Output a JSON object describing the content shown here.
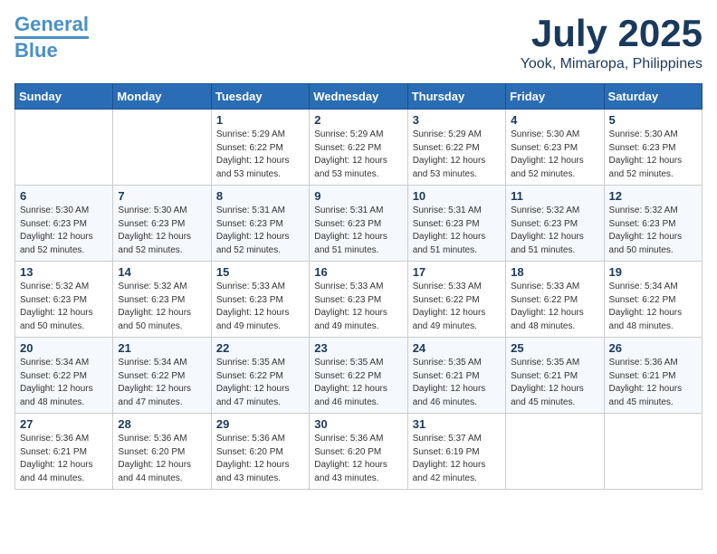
{
  "header": {
    "logo_line1": "General",
    "logo_line2": "Blue",
    "month": "July 2025",
    "location": "Yook, Mimaropa, Philippines"
  },
  "days_of_week": [
    "Sunday",
    "Monday",
    "Tuesday",
    "Wednesday",
    "Thursday",
    "Friday",
    "Saturday"
  ],
  "weeks": [
    [
      {
        "day": "",
        "content": ""
      },
      {
        "day": "",
        "content": ""
      },
      {
        "day": "1",
        "content": "Sunrise: 5:29 AM\nSunset: 6:22 PM\nDaylight: 12 hours and 53 minutes."
      },
      {
        "day": "2",
        "content": "Sunrise: 5:29 AM\nSunset: 6:22 PM\nDaylight: 12 hours and 53 minutes."
      },
      {
        "day": "3",
        "content": "Sunrise: 5:29 AM\nSunset: 6:22 PM\nDaylight: 12 hours and 53 minutes."
      },
      {
        "day": "4",
        "content": "Sunrise: 5:30 AM\nSunset: 6:23 PM\nDaylight: 12 hours and 52 minutes."
      },
      {
        "day": "5",
        "content": "Sunrise: 5:30 AM\nSunset: 6:23 PM\nDaylight: 12 hours and 52 minutes."
      }
    ],
    [
      {
        "day": "6",
        "content": "Sunrise: 5:30 AM\nSunset: 6:23 PM\nDaylight: 12 hours and 52 minutes."
      },
      {
        "day": "7",
        "content": "Sunrise: 5:30 AM\nSunset: 6:23 PM\nDaylight: 12 hours and 52 minutes."
      },
      {
        "day": "8",
        "content": "Sunrise: 5:31 AM\nSunset: 6:23 PM\nDaylight: 12 hours and 52 minutes."
      },
      {
        "day": "9",
        "content": "Sunrise: 5:31 AM\nSunset: 6:23 PM\nDaylight: 12 hours and 51 minutes."
      },
      {
        "day": "10",
        "content": "Sunrise: 5:31 AM\nSunset: 6:23 PM\nDaylight: 12 hours and 51 minutes."
      },
      {
        "day": "11",
        "content": "Sunrise: 5:32 AM\nSunset: 6:23 PM\nDaylight: 12 hours and 51 minutes."
      },
      {
        "day": "12",
        "content": "Sunrise: 5:32 AM\nSunset: 6:23 PM\nDaylight: 12 hours and 50 minutes."
      }
    ],
    [
      {
        "day": "13",
        "content": "Sunrise: 5:32 AM\nSunset: 6:23 PM\nDaylight: 12 hours and 50 minutes."
      },
      {
        "day": "14",
        "content": "Sunrise: 5:32 AM\nSunset: 6:23 PM\nDaylight: 12 hours and 50 minutes."
      },
      {
        "day": "15",
        "content": "Sunrise: 5:33 AM\nSunset: 6:23 PM\nDaylight: 12 hours and 49 minutes."
      },
      {
        "day": "16",
        "content": "Sunrise: 5:33 AM\nSunset: 6:23 PM\nDaylight: 12 hours and 49 minutes."
      },
      {
        "day": "17",
        "content": "Sunrise: 5:33 AM\nSunset: 6:22 PM\nDaylight: 12 hours and 49 minutes."
      },
      {
        "day": "18",
        "content": "Sunrise: 5:33 AM\nSunset: 6:22 PM\nDaylight: 12 hours and 48 minutes."
      },
      {
        "day": "19",
        "content": "Sunrise: 5:34 AM\nSunset: 6:22 PM\nDaylight: 12 hours and 48 minutes."
      }
    ],
    [
      {
        "day": "20",
        "content": "Sunrise: 5:34 AM\nSunset: 6:22 PM\nDaylight: 12 hours and 48 minutes."
      },
      {
        "day": "21",
        "content": "Sunrise: 5:34 AM\nSunset: 6:22 PM\nDaylight: 12 hours and 47 minutes."
      },
      {
        "day": "22",
        "content": "Sunrise: 5:35 AM\nSunset: 6:22 PM\nDaylight: 12 hours and 47 minutes."
      },
      {
        "day": "23",
        "content": "Sunrise: 5:35 AM\nSunset: 6:22 PM\nDaylight: 12 hours and 46 minutes."
      },
      {
        "day": "24",
        "content": "Sunrise: 5:35 AM\nSunset: 6:21 PM\nDaylight: 12 hours and 46 minutes."
      },
      {
        "day": "25",
        "content": "Sunrise: 5:35 AM\nSunset: 6:21 PM\nDaylight: 12 hours and 45 minutes."
      },
      {
        "day": "26",
        "content": "Sunrise: 5:36 AM\nSunset: 6:21 PM\nDaylight: 12 hours and 45 minutes."
      }
    ],
    [
      {
        "day": "27",
        "content": "Sunrise: 5:36 AM\nSunset: 6:21 PM\nDaylight: 12 hours and 44 minutes."
      },
      {
        "day": "28",
        "content": "Sunrise: 5:36 AM\nSunset: 6:20 PM\nDaylight: 12 hours and 44 minutes."
      },
      {
        "day": "29",
        "content": "Sunrise: 5:36 AM\nSunset: 6:20 PM\nDaylight: 12 hours and 43 minutes."
      },
      {
        "day": "30",
        "content": "Sunrise: 5:36 AM\nSunset: 6:20 PM\nDaylight: 12 hours and 43 minutes."
      },
      {
        "day": "31",
        "content": "Sunrise: 5:37 AM\nSunset: 6:19 PM\nDaylight: 12 hours and 42 minutes."
      },
      {
        "day": "",
        "content": ""
      },
      {
        "day": "",
        "content": ""
      }
    ]
  ]
}
